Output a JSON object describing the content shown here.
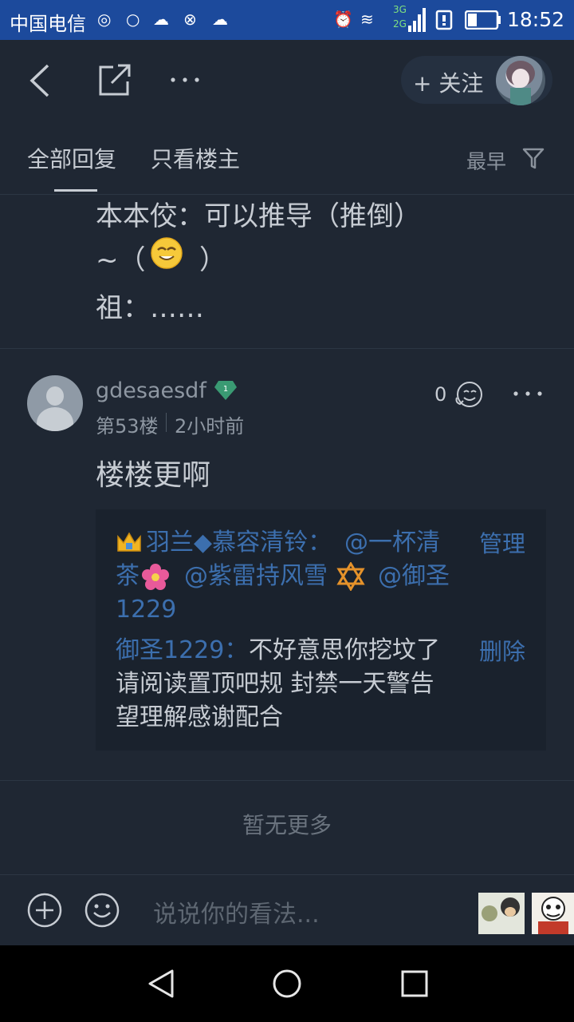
{
  "status_bar": {
    "carrier": "中国电信",
    "time": "18:52",
    "network_3g": "3G",
    "network_2g": "2G"
  },
  "app_bar": {
    "follow_label": "+ 关注"
  },
  "tabs": {
    "all_replies": "全部回复",
    "owner_only": "只看楼主",
    "sort_label": "最早"
  },
  "previous_post": {
    "line1": "本本佼：可以推导（推倒）",
    "line2_prefix": "~（",
    "line2_suffix": "）",
    "line3": "祖：……"
  },
  "post": {
    "username": "gdesaesdf",
    "level": "1",
    "floor": "第53楼",
    "time": "2小时前",
    "like_count": "0",
    "content": "楼楼更啊",
    "reply1": {
      "author": "羽兰◆慕容清铃：",
      "mention1": "@一杯清",
      "mention1b": "茶",
      "mention2": "@紫雷持风雪",
      "mention3": "@御圣",
      "mention3b": "1229",
      "action": "管理"
    },
    "reply2": {
      "author": "御圣1229：",
      "text1": "不好意思你挖坟了",
      "text2": "请阅读置顶吧规 封禁一天警告",
      "text3": "望理解感谢配合",
      "action": "删除"
    }
  },
  "footer": {
    "no_more": "暂无更多"
  },
  "input_bar": {
    "placeholder": "说说你的看法..."
  },
  "colors": {
    "background": "#1f2733",
    "status_bar": "#1c4a9c",
    "link_blue": "#3c6fae",
    "level_badge": "#3a9a73"
  }
}
